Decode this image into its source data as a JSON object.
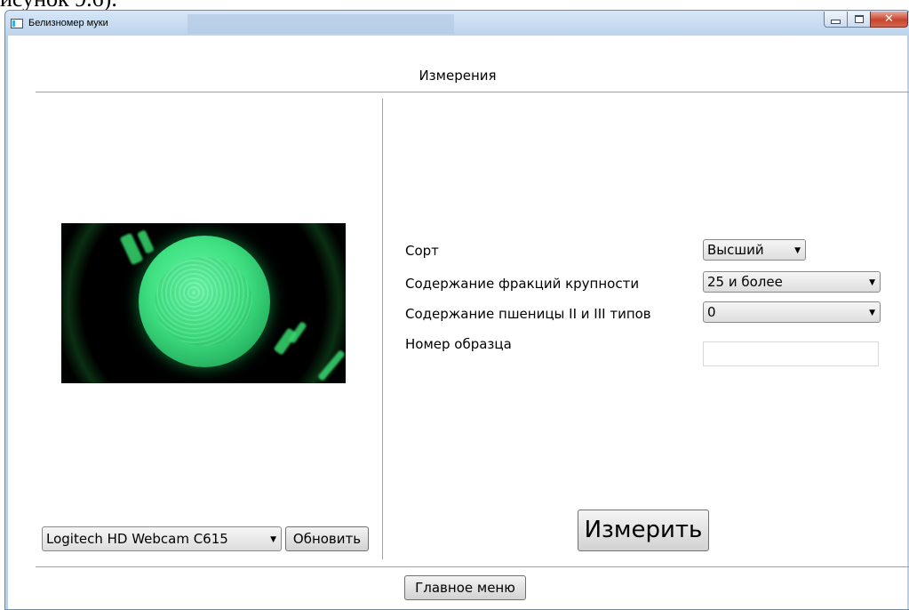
{
  "document_fragment": "исунок 9.6).",
  "window": {
    "title": "Белизномер муки",
    "controls": {
      "minimize_icon": "minimize-icon",
      "maximize_icon": "maximize-icon",
      "close_icon": "close-icon"
    }
  },
  "section": {
    "title": "Измерения"
  },
  "form": {
    "grade": {
      "label": "Сорт",
      "value": "Высший"
    },
    "fraction": {
      "label": "Содержание фракций крупности",
      "value": "25 и более"
    },
    "wheat": {
      "label": "Содержание пшеницы II и III типов",
      "value": "0"
    },
    "sample": {
      "label": "Номер образца",
      "value": ""
    }
  },
  "buttons": {
    "measure": "Измерить",
    "refresh": "Обновить",
    "main_menu": "Главное меню"
  },
  "camera": {
    "device": "Logitech HD Webcam C615"
  },
  "colors": {
    "camera_glow": "#3fe081",
    "title_bar": "#bcd3ec",
    "close_button": "#c7452d"
  }
}
